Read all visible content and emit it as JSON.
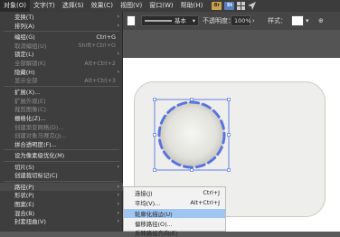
{
  "menubar": {
    "items": [
      "对象(O)",
      "文字(T)",
      "选择(S)",
      "效果(C)",
      "视图(V)",
      "窗口(W)",
      "帮助(H)"
    ],
    "app_icons": [
      "Br",
      "St"
    ],
    "app_icon_colors": [
      "#c8a24a",
      "#5a7fbf"
    ]
  },
  "toolbar": {
    "stroke_label": "基本",
    "opacity_label": "不透明度：",
    "opacity_value": "100%",
    "style_label": "样式："
  },
  "menu": {
    "items": [
      {
        "label": "变换(T)",
        "shortcut": "",
        "submenu": true,
        "disabled": false
      },
      {
        "label": "排列(A)",
        "shortcut": "",
        "submenu": true,
        "disabled": false
      },
      {
        "label": "编组(G)",
        "shortcut": "Ctrl+G",
        "submenu": false,
        "disabled": false
      },
      {
        "label": "取消编组(U)",
        "shortcut": "Shift+Ctrl+G",
        "submenu": false,
        "disabled": true
      },
      {
        "label": "锁定(L)",
        "shortcut": "",
        "submenu": true,
        "disabled": false
      },
      {
        "label": "全部解锁(K)",
        "shortcut": "Alt+Ctrl+2",
        "submenu": false,
        "disabled": true
      },
      {
        "label": "隐藏(H)",
        "shortcut": "",
        "submenu": true,
        "disabled": false
      },
      {
        "label": "显示全部",
        "shortcut": "Alt+Ctrl+3",
        "submenu": false,
        "disabled": true
      },
      {
        "label": "扩展(X)...",
        "shortcut": "",
        "submenu": false,
        "disabled": false
      },
      {
        "label": "扩展外观(E)",
        "shortcut": "",
        "submenu": false,
        "disabled": true
      },
      {
        "label": "裁剪图像(C)",
        "shortcut": "",
        "submenu": false,
        "disabled": true
      },
      {
        "label": "栅格化(Z)...",
        "shortcut": "",
        "submenu": false,
        "disabled": false
      },
      {
        "label": "创建渐变网格(D)...",
        "shortcut": "",
        "submenu": false,
        "disabled": true
      },
      {
        "label": "创建对象马赛克(J)...",
        "shortcut": "",
        "submenu": false,
        "disabled": true
      },
      {
        "label": "拼合透明度(F)...",
        "shortcut": "",
        "submenu": false,
        "disabled": false
      },
      {
        "label": "设为像素级优化(M)",
        "shortcut": "",
        "submenu": false,
        "disabled": false
      },
      {
        "label": "切片(S)",
        "shortcut": "",
        "submenu": true,
        "disabled": false
      },
      {
        "label": "创建裁切标记(C)",
        "shortcut": "",
        "submenu": false,
        "disabled": false
      },
      {
        "label": "路径(P)",
        "shortcut": "",
        "submenu": true,
        "disabled": false
      },
      {
        "label": "形状(P)",
        "shortcut": "",
        "submenu": true,
        "disabled": false
      },
      {
        "label": "图案(E)",
        "shortcut": "",
        "submenu": true,
        "disabled": false
      },
      {
        "label": "混合(B)",
        "shortcut": "",
        "submenu": true,
        "disabled": false
      },
      {
        "label": "封套扭曲(V)",
        "shortcut": "",
        "submenu": true,
        "disabled": false
      }
    ]
  },
  "submenu": {
    "items": [
      {
        "label": "连接(J)",
        "shortcut": "Ctrl+J"
      },
      {
        "label": "平均(V)...",
        "shortcut": "Alt+Ctrl+J"
      },
      {
        "label": "轮廓化描边(U)",
        "shortcut": ""
      },
      {
        "label": "偏移路径(O)...",
        "shortcut": ""
      },
      {
        "label": "反转路径方向(E)",
        "shortcut": ""
      }
    ]
  }
}
